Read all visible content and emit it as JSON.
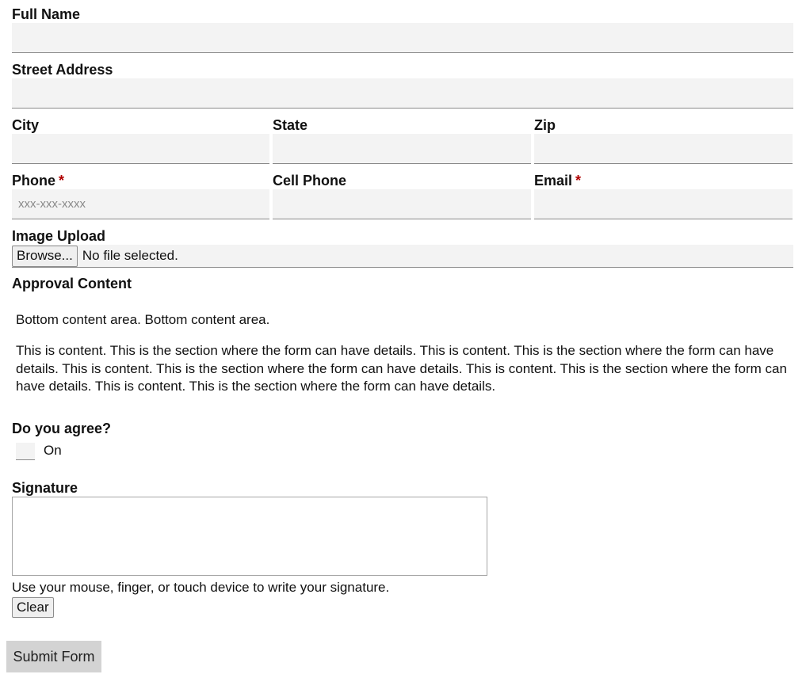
{
  "form": {
    "full_name": {
      "label": "Full Name",
      "value": ""
    },
    "street_address": {
      "label": "Street Address",
      "value": ""
    },
    "city": {
      "label": "City",
      "value": ""
    },
    "state": {
      "label": "State",
      "value": ""
    },
    "zip": {
      "label": "Zip",
      "value": ""
    },
    "phone": {
      "label": "Phone",
      "required_mark": "*",
      "placeholder": "xxx-xxx-xxxx",
      "value": ""
    },
    "cell_phone": {
      "label": "Cell Phone",
      "value": ""
    },
    "email": {
      "label": "Email",
      "required_mark": "*",
      "value": ""
    },
    "image_upload": {
      "label": "Image Upload",
      "browse_label": "Browse...",
      "status": "No file selected."
    },
    "approval": {
      "heading": "Approval Content",
      "bottom_text": "Bottom content area. Bottom content area.",
      "details_text": "This is content. This is the section where the form can have details. This is content. This is the section where the form can have details. This is content. This is the section where the form can have details. This is content. This is the section where the form can have details. This is content. This is the section where the form can have details."
    },
    "agree": {
      "label": "Do you agree?",
      "option_label": "On",
      "checked": false
    },
    "signature": {
      "label": "Signature",
      "instructions": "Use your mouse, finger, or touch device to write your signature.",
      "clear_label": "Clear"
    },
    "submit_label": "Submit Form"
  },
  "colors": {
    "field_bg": "#f3f3f3",
    "field_border": "#8a8a8a",
    "required": "#b00000",
    "submit_bg": "#d3d3d3"
  }
}
